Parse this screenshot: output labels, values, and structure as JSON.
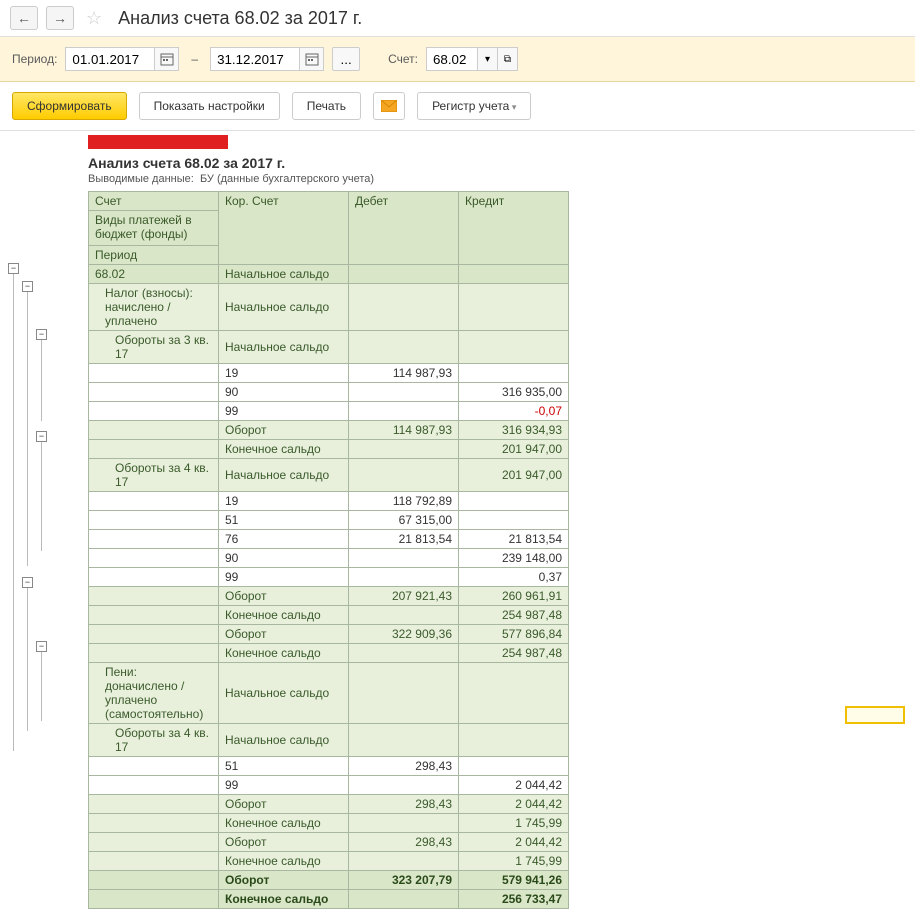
{
  "header": {
    "title": "Анализ счета 68.02 за 2017 г."
  },
  "params": {
    "period_label": "Период:",
    "date_from": "01.01.2017",
    "date_to": "31.12.2017",
    "dash": "–",
    "more": "...",
    "account_label": "Счет:",
    "account": "68.02",
    "dropdown": "▾",
    "expand": "⧉"
  },
  "actions": {
    "generate": "Сформировать",
    "show_settings": "Показать настройки",
    "print": "Печать",
    "register": "Регистр учета"
  },
  "report": {
    "title": "Анализ счета 68.02 за 2017 г.",
    "subtitle_label": "Выводимые данные:",
    "subtitle_value": "БУ (данные бухгалтерского учета)",
    "headers": {
      "account": "Счет",
      "corr": "Кор. Счет",
      "debit": "Дебет",
      "credit": "Кредит",
      "payment_types": "Виды платежей в бюджет (фонды)",
      "period": "Период"
    },
    "rows": [
      {
        "a": "68.02",
        "c": "Начальное сальдо",
        "d": "",
        "k": "",
        "cls": "h1"
      },
      {
        "a": "Налог (взносы): начислено / уплачено",
        "c": "Начальное сальдо",
        "d": "",
        "k": "",
        "cls": "h2",
        "indent": 1
      },
      {
        "a": "Обороты за 3 кв. 17",
        "c": "Начальное сальдо",
        "d": "",
        "k": "",
        "cls": "h2",
        "indent": 2
      },
      {
        "a": "",
        "c": "19",
        "d": "114 987,93",
        "k": "",
        "indent": 3
      },
      {
        "a": "",
        "c": "90",
        "d": "",
        "k": "316 935,00",
        "indent": 3
      },
      {
        "a": "",
        "c": "99",
        "d": "",
        "k": "-0,07",
        "indent": 3,
        "neg": true
      },
      {
        "a": "",
        "c": "Оборот",
        "d": "114 987,93",
        "k": "316 934,93",
        "cls": "h2",
        "indent": 3
      },
      {
        "a": "",
        "c": "Конечное сальдо",
        "d": "",
        "k": "201 947,00",
        "cls": "h2",
        "indent": 3
      },
      {
        "a": "Обороты за 4 кв. 17",
        "c": "Начальное сальдо",
        "d": "",
        "k": "201 947,00",
        "cls": "h2",
        "indent": 2
      },
      {
        "a": "",
        "c": "19",
        "d": "118 792,89",
        "k": "",
        "indent": 3
      },
      {
        "a": "",
        "c": "51",
        "d": "67 315,00",
        "k": "",
        "indent": 3
      },
      {
        "a": "",
        "c": "76",
        "d": "21 813,54",
        "k": "21 813,54",
        "indent": 3
      },
      {
        "a": "",
        "c": "90",
        "d": "",
        "k": "239 148,00",
        "indent": 3
      },
      {
        "a": "",
        "c": "99",
        "d": "",
        "k": "0,37",
        "indent": 3
      },
      {
        "a": "",
        "c": "Оборот",
        "d": "207 921,43",
        "k": "260 961,91",
        "cls": "h2",
        "indent": 3
      },
      {
        "a": "",
        "c": "Конечное сальдо",
        "d": "",
        "k": "254 987,48",
        "cls": "h2",
        "indent": 3
      },
      {
        "a": "",
        "c": "Оборот",
        "d": "322 909,36",
        "k": "577 896,84",
        "cls": "h2",
        "indent": 2
      },
      {
        "a": "",
        "c": "Конечное сальдо",
        "d": "",
        "k": "254 987,48",
        "cls": "h2",
        "indent": 2
      },
      {
        "a": "Пени: доначислено / уплачено (самостоятельно)",
        "c": "Начальное сальдо",
        "d": "",
        "k": "",
        "cls": "h2",
        "indent": 1
      },
      {
        "a": "Обороты за 4 кв. 17",
        "c": "Начальное сальдо",
        "d": "",
        "k": "",
        "cls": "h2",
        "indent": 2
      },
      {
        "a": "",
        "c": "51",
        "d": "298,43",
        "k": "",
        "indent": 3
      },
      {
        "a": "",
        "c": "99",
        "d": "",
        "k": "2 044,42",
        "indent": 3
      },
      {
        "a": "",
        "c": "Оборот",
        "d": "298,43",
        "k": "2 044,42",
        "cls": "h2",
        "indent": 3
      },
      {
        "a": "",
        "c": "Конечное сальдо",
        "d": "",
        "k": "1 745,99",
        "cls": "h2",
        "indent": 3
      },
      {
        "a": "",
        "c": "Оборот",
        "d": "298,43",
        "k": "2 044,42",
        "cls": "h2",
        "indent": 2
      },
      {
        "a": "",
        "c": "Конечное сальдо",
        "d": "",
        "k": "1 745,99",
        "cls": "h2",
        "indent": 2
      },
      {
        "a": "",
        "c": "Оборот",
        "d": "323 207,79",
        "k": "579 941,26",
        "cls": "total"
      },
      {
        "a": "",
        "c": "Конечное сальдо",
        "d": "",
        "k": "256 733,47",
        "cls": "total"
      }
    ]
  }
}
